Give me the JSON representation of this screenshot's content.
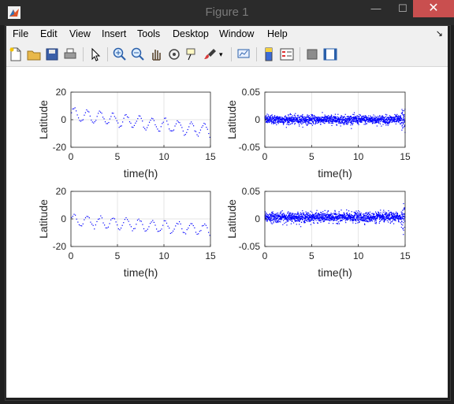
{
  "window": {
    "title": "Figure 1",
    "controls": {
      "minimize": "—",
      "maximize": "☐",
      "close": "✕"
    }
  },
  "menu": {
    "items": [
      "File",
      "Edit",
      "View",
      "Insert",
      "Tools",
      "Desktop",
      "Window",
      "Help"
    ],
    "dock_arrow": "↘"
  },
  "toolbar": {
    "icons": [
      "new-figure-icon",
      "open-file-icon",
      "save-icon",
      "print-icon",
      "pointer-icon",
      "zoom-in-icon",
      "zoom-out-icon",
      "pan-hand-icon",
      "rotate-3d-icon",
      "data-cursor-icon",
      "brush-icon",
      "brush-dropdown-icon",
      "link-plot-icon",
      "colorbar-icon",
      "legend-icon",
      "hide-plot-tools-icon",
      "show-plot-tools-icon"
    ]
  },
  "colors": {
    "data": "#0000ff",
    "grid": "#dcdcdc",
    "axis": "#262626"
  },
  "chart_data": [
    {
      "type": "scatter",
      "xlabel": "time(h)",
      "ylabel": "Latitude",
      "xlim": [
        0,
        15
      ],
      "ylim": [
        -20,
        20
      ],
      "xticks": [
        "0",
        "5",
        "10",
        "15"
      ],
      "yticks": [
        "20",
        "0",
        "-20"
      ],
      "grid": true,
      "series": [
        {
          "pattern": "sparse-oscillation",
          "amplitude": 4.5,
          "period_h": 1.4,
          "trend_start": 4,
          "trend_end": -8,
          "point_count": 120
        }
      ]
    },
    {
      "type": "scatter",
      "xlabel": "time(h)",
      "ylabel": "Latitude",
      "xlim": [
        0,
        15
      ],
      "ylim": [
        -0.05,
        0.05
      ],
      "xticks": [
        "0",
        "5",
        "10",
        "15"
      ],
      "yticks": [
        "0.05",
        "0",
        "-0.05"
      ],
      "grid": true,
      "series": [
        {
          "pattern": "dense-noise",
          "center": 0.0,
          "spread": 0.008,
          "point_count": 1500
        }
      ]
    },
    {
      "type": "scatter",
      "xlabel": "time(h)",
      "ylabel": "Latitude",
      "xlim": [
        0,
        15
      ],
      "ylim": [
        -20,
        20
      ],
      "xticks": [
        "0",
        "5",
        "10",
        "15"
      ],
      "yticks": [
        "20",
        "0",
        "-20"
      ],
      "grid": true,
      "series": [
        {
          "pattern": "sparse-oscillation",
          "amplitude": 4.0,
          "period_h": 1.4,
          "trend_start": -1,
          "trend_end": -8,
          "point_count": 110
        }
      ]
    },
    {
      "type": "scatter",
      "xlabel": "time(h)",
      "ylabel": "Latitude",
      "xlim": [
        0,
        15
      ],
      "ylim": [
        -0.05,
        0.05
      ],
      "xticks": [
        "0",
        "5",
        "10",
        "15"
      ],
      "yticks": [
        "0.05",
        "0",
        "-0.05"
      ],
      "grid": true,
      "series": [
        {
          "pattern": "dense-noise",
          "center": 0.003,
          "spread": 0.009,
          "point_count": 1500
        }
      ]
    }
  ]
}
